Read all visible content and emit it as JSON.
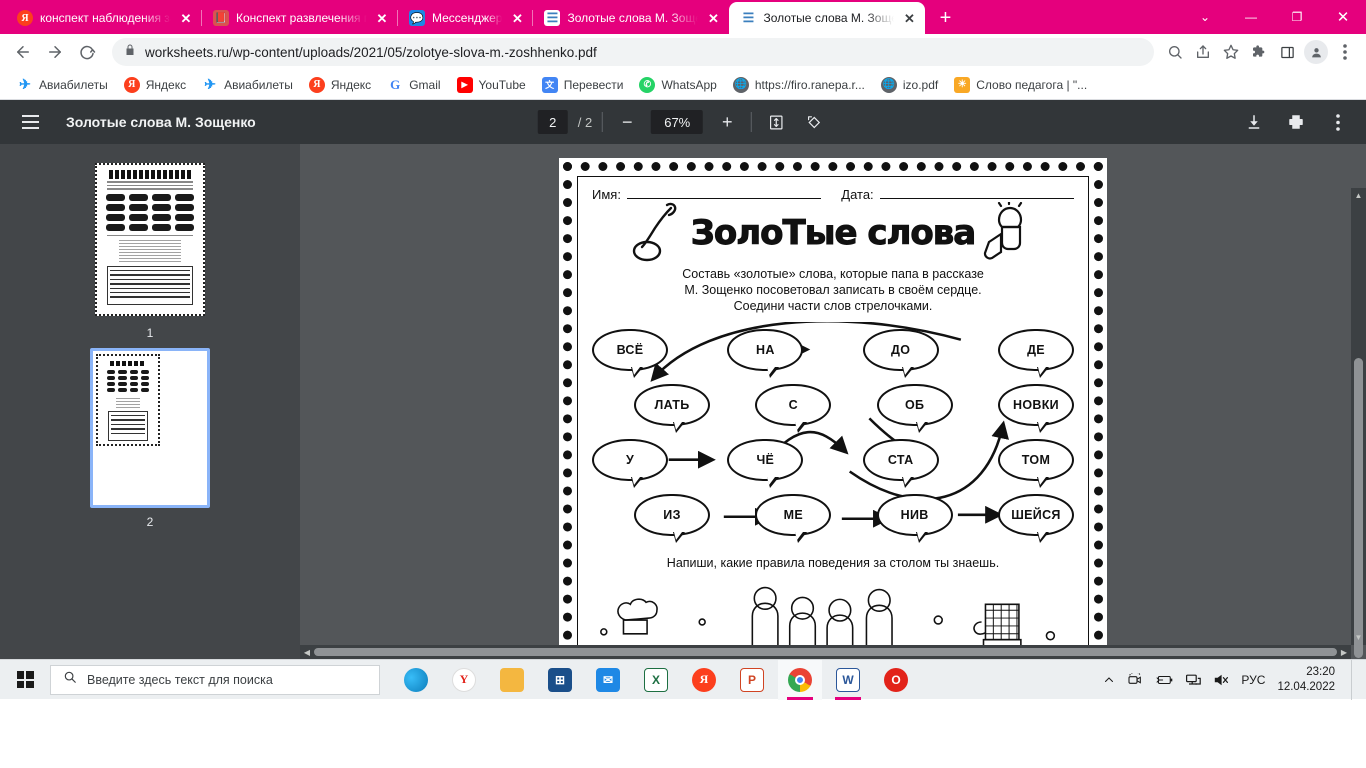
{
  "browser": {
    "theme_color": "#e5007d",
    "tabs": [
      {
        "title": "конспект наблюдения за хо",
        "favicon": "yandex-icon",
        "active": false
      },
      {
        "title": "Конспект развлечения по э",
        "favicon": "document-icon",
        "active": false
      },
      {
        "title": "Мессенджер",
        "favicon": "messenger-icon",
        "active": false
      },
      {
        "title": "Золотые слова М. Зощенко",
        "favicon": "worksheets-icon",
        "active": false
      },
      {
        "title": "Золотые слова М. Зощенко",
        "favicon": "worksheets-icon",
        "active": true
      }
    ],
    "new_tab_label": "+",
    "close_label": "✕",
    "window_controls": {
      "list": "⌄",
      "minimize": "—",
      "maximize": "❐",
      "close": "✕"
    },
    "url": "worksheets.ru/wp-content/uploads/2021/05/zolotye-slova-m.-zoshhenko.pdf",
    "bookmarks": [
      {
        "label": "Авиабилеты",
        "icon": "airplane-icon"
      },
      {
        "label": "Яндекс",
        "icon": "yandex-icon"
      },
      {
        "label": "Авиабилеты",
        "icon": "airplane-icon"
      },
      {
        "label": "Яндекс",
        "icon": "yandex-icon"
      },
      {
        "label": "Gmail",
        "icon": "gmail-icon"
      },
      {
        "label": "YouTube",
        "icon": "youtube-icon"
      },
      {
        "label": "Перевести",
        "icon": "translate-icon"
      },
      {
        "label": "WhatsApp",
        "icon": "whatsapp-icon"
      },
      {
        "label": "https://firo.ranepa.r...",
        "icon": "globe-icon"
      },
      {
        "label": "izo.pdf",
        "icon": "globe-icon"
      },
      {
        "label": "Слово педагога | \"...",
        "icon": "sun-icon"
      }
    ]
  },
  "pdf_viewer": {
    "document_title": "Золотые слова М. Зощенко",
    "current_page": "2",
    "page_separator": "/",
    "total_pages": "2",
    "zoom_level": "67%",
    "zoom_out_label": "−",
    "zoom_in_label": "+",
    "thumbnails": [
      {
        "number": "1",
        "selected": false
      },
      {
        "number": "2",
        "selected": true
      }
    ]
  },
  "worksheet": {
    "name_label": "Имя:",
    "date_label": "Дата:",
    "title": "ЗолоТые слова",
    "instructions_line1": "Составь «золотые» слова, которые папа в рассказе",
    "instructions_line2": "М. Зощенко посоветовал записать в своём сердце.",
    "instructions_line3": "Соедини части слов стрелочками.",
    "bubble_rows": [
      [
        "ВСЁ",
        "НА",
        "ДО",
        "ДЕ"
      ],
      [
        "ЛАТЬ",
        "С",
        "ОБ",
        "НОВКИ"
      ],
      [
        "У",
        "ЧЁ",
        "СТА",
        "ТОМ"
      ],
      [
        "ИЗ",
        "МЕ",
        "НИВ",
        "ШЕЙСЯ"
      ]
    ],
    "bottom_prompt": "Напиши, какие правила поведения за столом ты знаешь."
  },
  "taskbar": {
    "search_placeholder": "Введите здесь текст для поиска",
    "apps": [
      {
        "name": "edge",
        "label": "e",
        "color": "#0c7dbb"
      },
      {
        "name": "yandex",
        "label": "Y",
        "color": "#ffffff"
      },
      {
        "name": "file-explorer",
        "label": "",
        "color": "#f7b731"
      },
      {
        "name": "microsoft-store",
        "label": "⊞",
        "color": "#1b4f8a"
      },
      {
        "name": "mail",
        "label": "✉",
        "color": "#1e88e5"
      },
      {
        "name": "excel",
        "label": "X",
        "color": "#1d6f42"
      },
      {
        "name": "yandex-browser",
        "label": "Я",
        "color": "#fc3f1d"
      },
      {
        "name": "powerpoint",
        "label": "P",
        "color": "#d04423"
      },
      {
        "name": "chrome",
        "label": "",
        "color": "#4285f4"
      },
      {
        "name": "word",
        "label": "W",
        "color": "#2b579a"
      },
      {
        "name": "opera",
        "label": "O",
        "color": "#e2231a"
      }
    ],
    "language": "РУС",
    "time": "23:20",
    "date": "12.04.2022"
  }
}
